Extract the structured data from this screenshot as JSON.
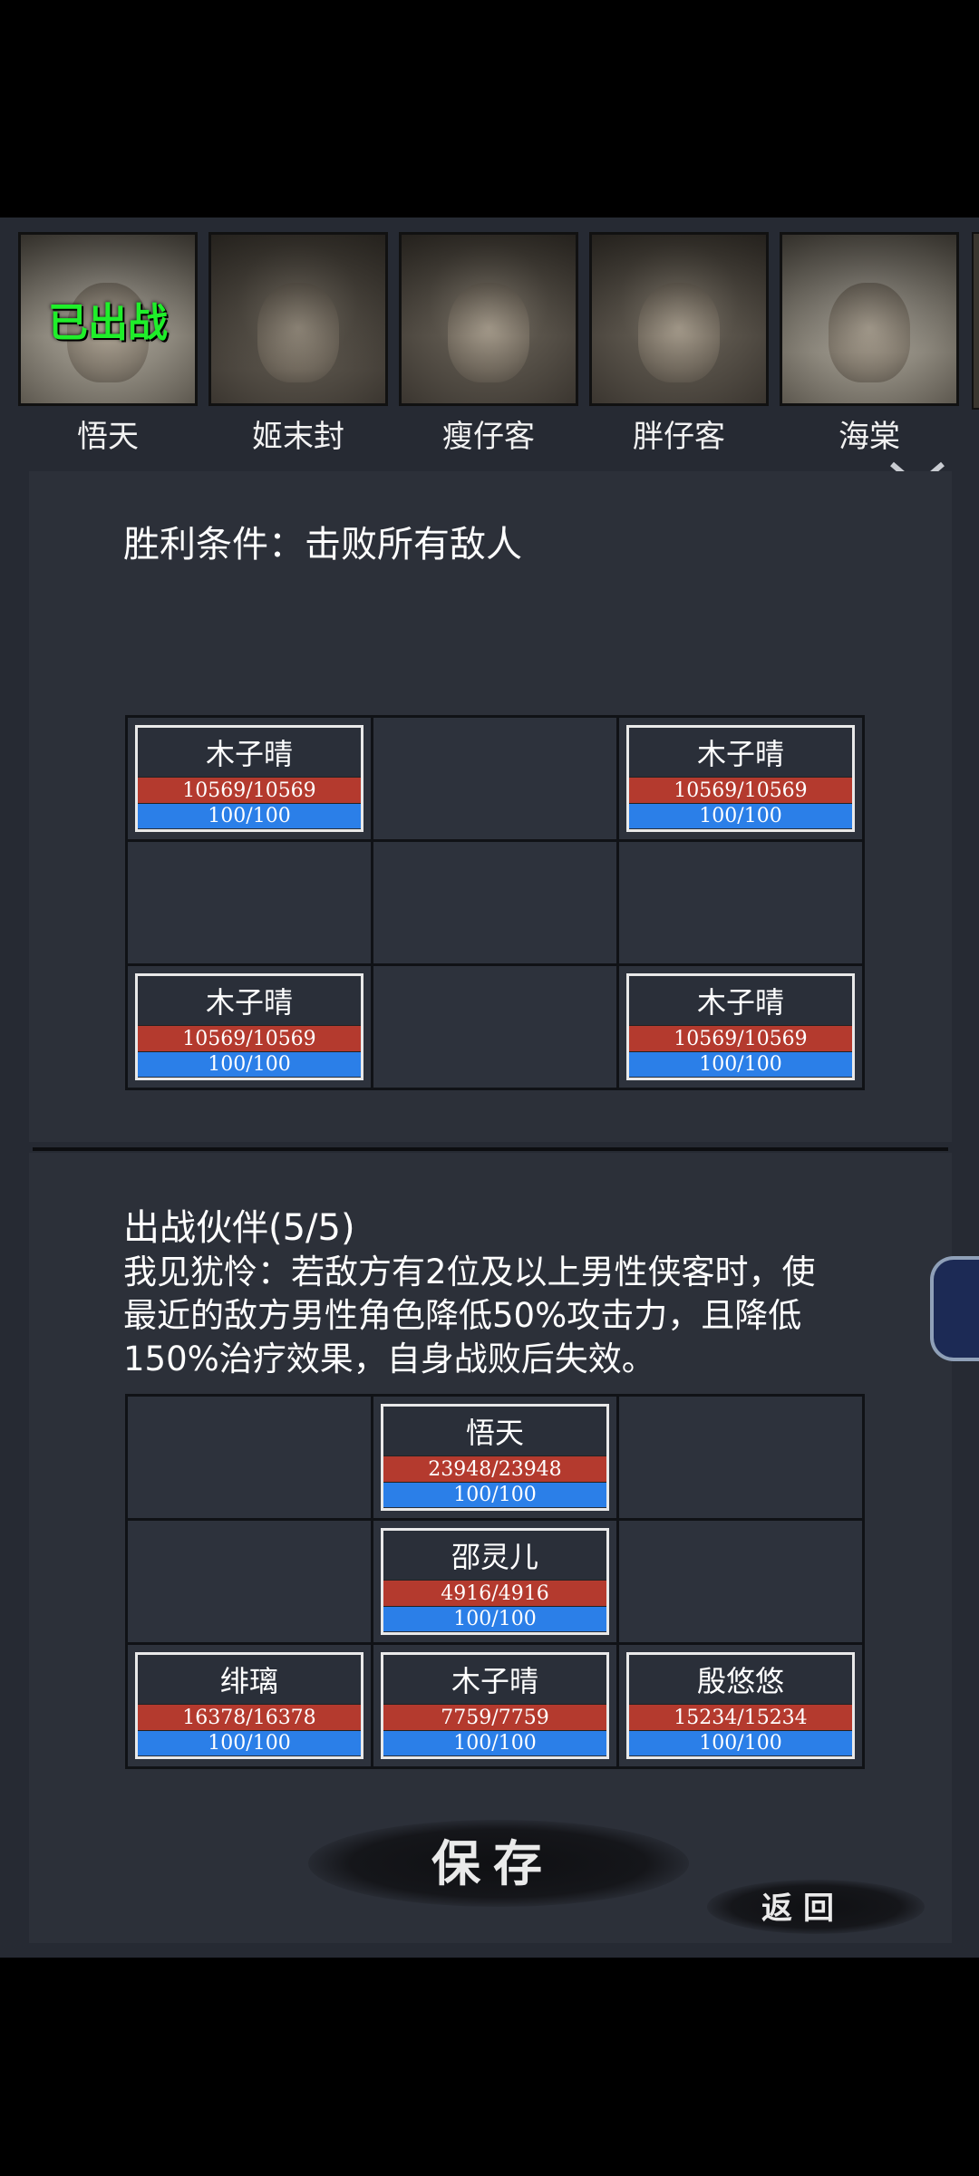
{
  "heroes": [
    {
      "name": "悟天",
      "badge": "已出战"
    },
    {
      "name": "姬末封",
      "badge": ""
    },
    {
      "name": "瘦仔客",
      "badge": ""
    },
    {
      "name": "胖仔客",
      "badge": ""
    },
    {
      "name": "海棠",
      "badge": ""
    }
  ],
  "victory_condition": "胜利条件：击败所有敌人",
  "enemy_grid": [
    {
      "name": "木子晴",
      "hp": "10569/10569",
      "mp": "100/100"
    },
    null,
    {
      "name": "木子晴",
      "hp": "10569/10569",
      "mp": "100/100"
    },
    null,
    null,
    null,
    {
      "name": "木子晴",
      "hp": "10569/10569",
      "mp": "100/100"
    },
    null,
    {
      "name": "木子晴",
      "hp": "10569/10569",
      "mp": "100/100"
    }
  ],
  "partners_title": "出战伙伴(5/5)",
  "skill_text": "我见犹怜：若敌方有2位及以上男性侠客时，使最近的敌方男性角色降低50%攻击力，且降低150%治疗效果，自身战败后失效。",
  "ally_grid": [
    null,
    {
      "name": "悟天",
      "hp": "23948/23948",
      "mp": "100/100"
    },
    null,
    null,
    {
      "name": "邵灵儿",
      "hp": "4916/4916",
      "mp": "100/100"
    },
    null,
    {
      "name": "绯璃",
      "hp": "16378/16378",
      "mp": "100/100"
    },
    {
      "name": "木子晴",
      "hp": "7759/7759",
      "mp": "100/100"
    },
    {
      "name": "殷悠悠",
      "hp": "15234/15234",
      "mp": "100/100"
    }
  ],
  "buttons": {
    "save": "保存",
    "back": "返回"
  },
  "colors": {
    "hp_bar": "#b43a2e",
    "mp_bar": "#2b7fe8",
    "deployed_badge": "#1fef2a"
  }
}
